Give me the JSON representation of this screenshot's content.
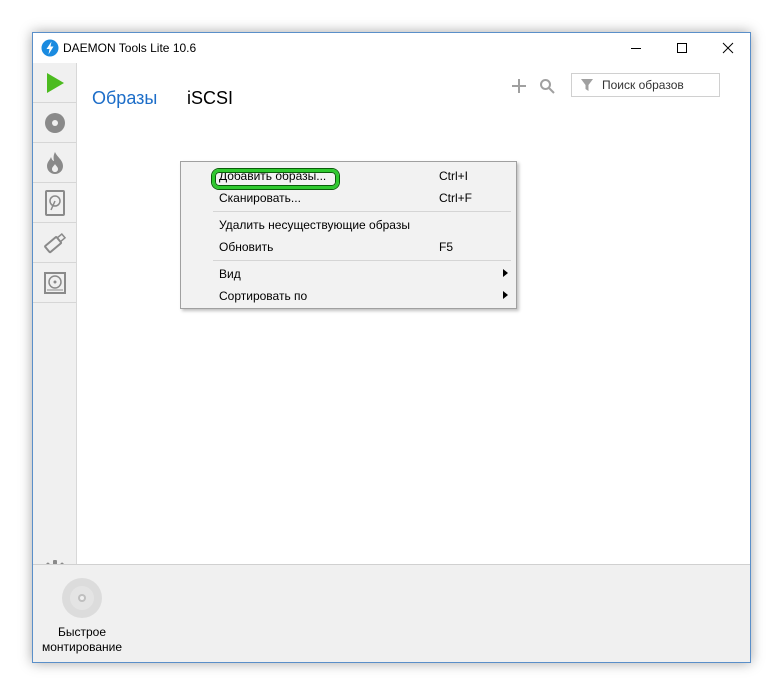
{
  "window": {
    "title": "DAEMON Tools Lite 10.6"
  },
  "titlebar_icons": [
    "daemon-tools-logo",
    "minimize-icon",
    "maximize-icon",
    "close-icon"
  ],
  "sidebar": {
    "items": [
      {
        "name": "play",
        "icon": "play-icon",
        "active": true
      },
      {
        "name": "disc",
        "icon": "disc-icon"
      },
      {
        "name": "burn",
        "icon": "flame-icon"
      },
      {
        "name": "virtual-hdd",
        "icon": "hard-drive-icon"
      },
      {
        "name": "usb",
        "icon": "usb-icon"
      },
      {
        "name": "cd-drive",
        "icon": "cd-drive-icon"
      }
    ],
    "settings_icon": "gear-icon"
  },
  "tabs": [
    {
      "label": "Образы",
      "active": true
    },
    {
      "label": "iSCSI",
      "active": false
    }
  ],
  "toolbar": {
    "add_icon": "plus-icon",
    "search_icon": "search-icon",
    "search_placeholder": "Поиск образов",
    "filter_icon": "filter-icon"
  },
  "context_menu": {
    "items": [
      {
        "label": "Добавить образы...",
        "shortcut": "Ctrl+I",
        "highlighted": true
      },
      {
        "label": "Сканировать...",
        "shortcut": "Ctrl+F"
      },
      {
        "label": "Удалить несуществующие образы",
        "shortcut": ""
      },
      {
        "label": "Обновить",
        "shortcut": "F5"
      },
      {
        "label": "Вид",
        "submenu": true
      },
      {
        "label": "Сортировать по",
        "submenu": true
      }
    ]
  },
  "bottom_panel": {
    "quick_mount_line1": "Быстрое",
    "quick_mount_line2": "монтирование"
  },
  "colors": {
    "accent_blue": "#1c6dc8",
    "play_green": "#4cbb1f",
    "highlight_green": "#2ec92e",
    "sidebar_bg": "#f0f0f0",
    "menu_bg": "#f2f2f2"
  }
}
